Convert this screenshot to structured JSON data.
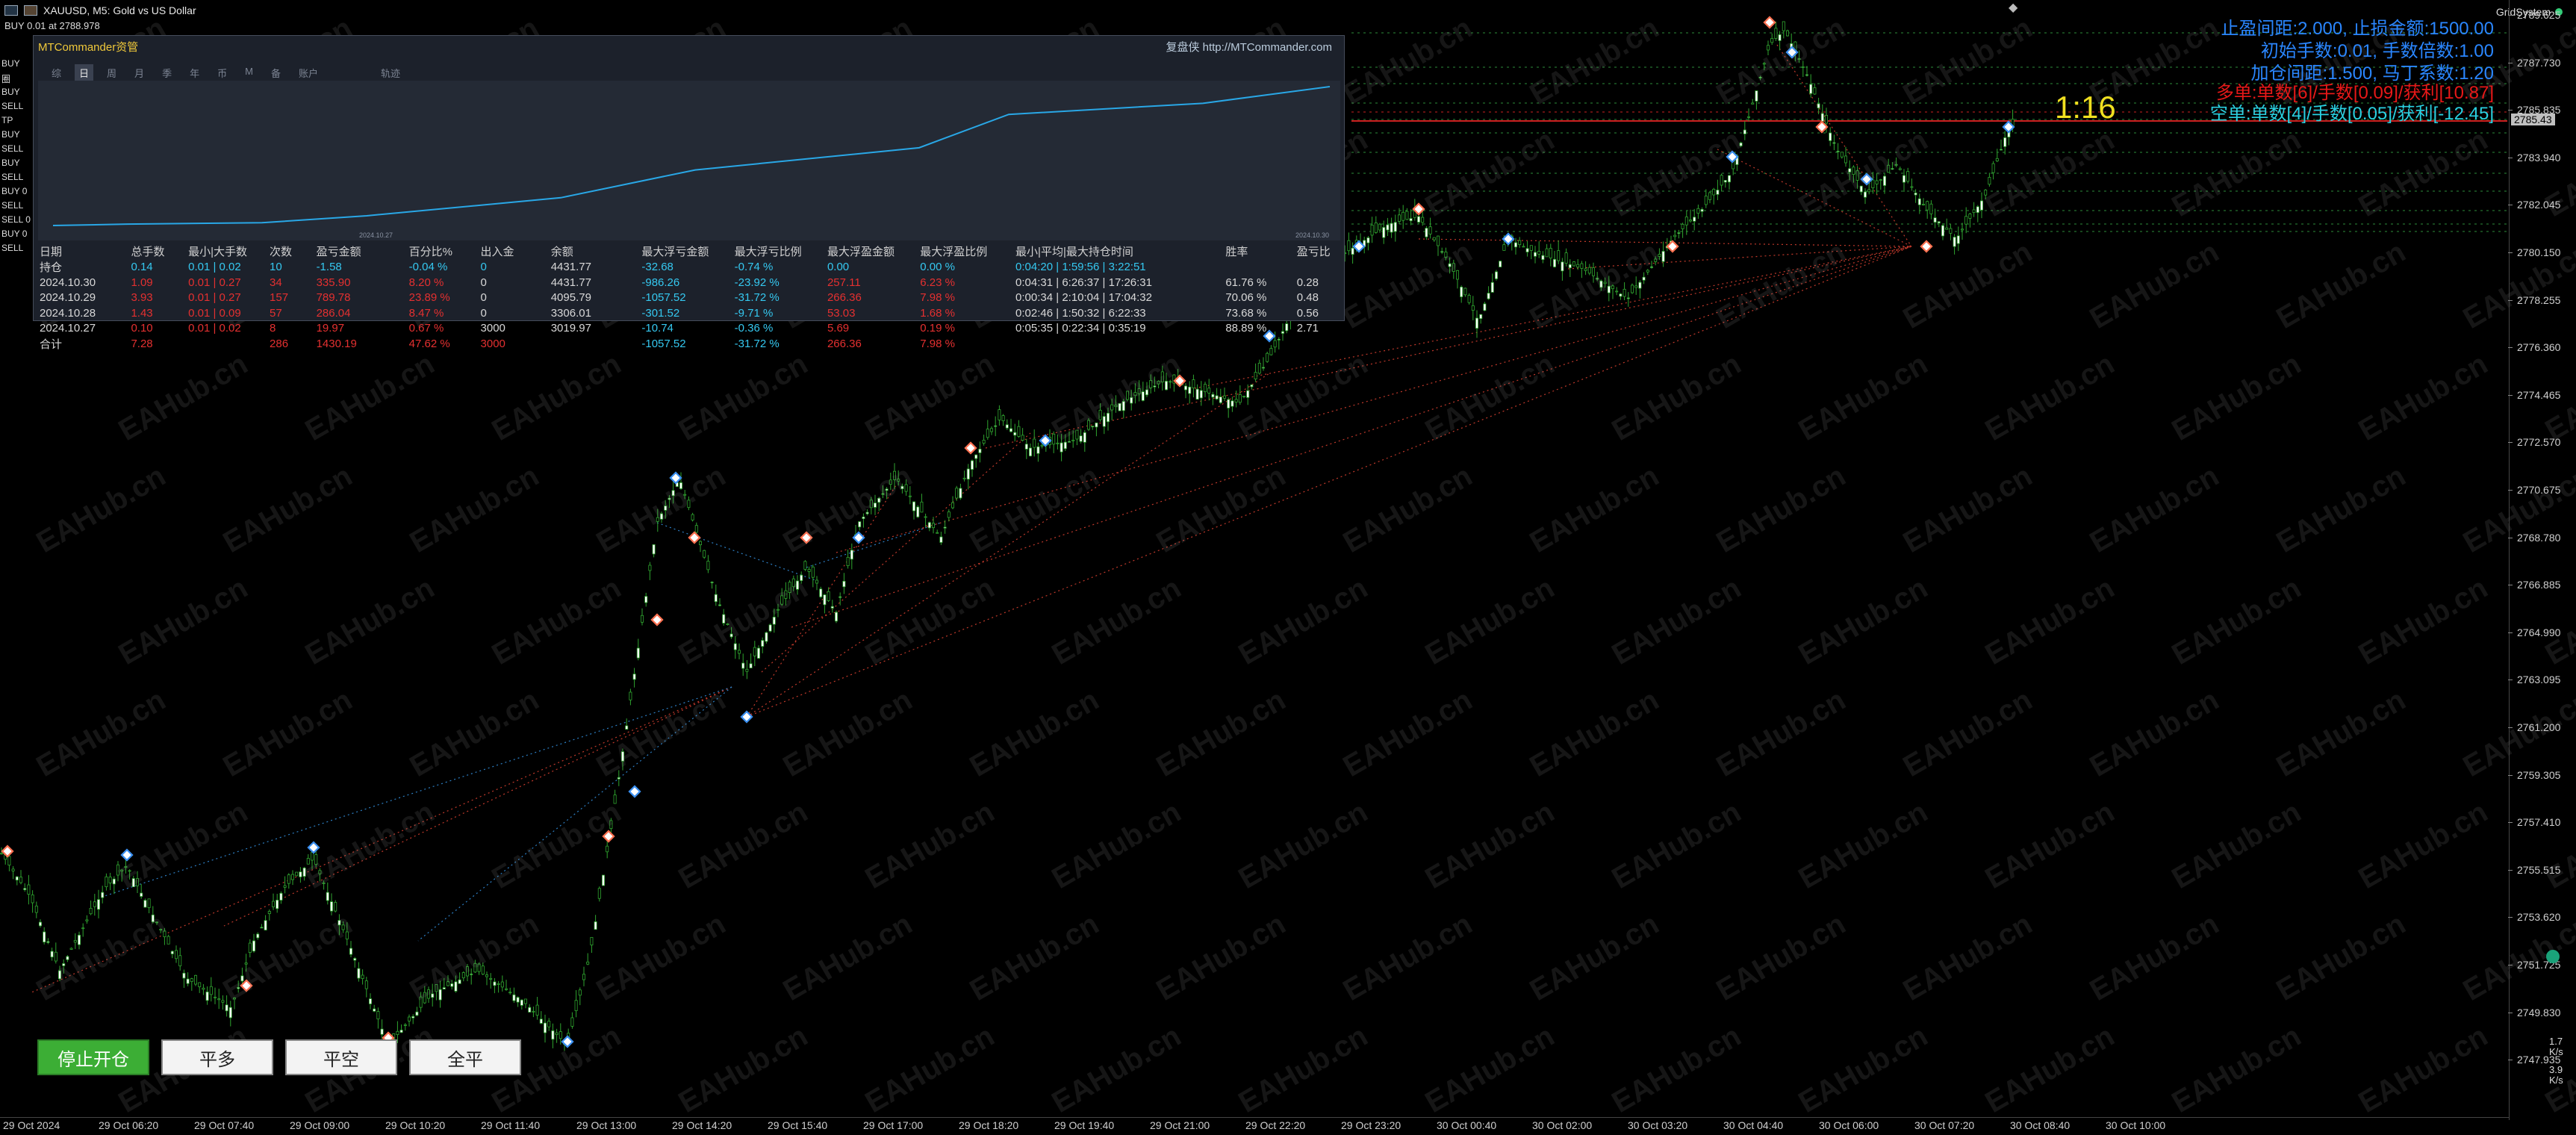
{
  "chart": {
    "symbol_title": "XAUUSD, M5:  Gold vs US Dollar",
    "order_line": "BUY 0.01 at 2788.978",
    "ea_name": "GridSystem",
    "watermark": "EAHub.cn",
    "side_labels": [
      "BUY",
      "圈",
      "BUY",
      "SELL",
      "TP",
      "BUY",
      "SELL",
      "BUY",
      "SELL",
      "BUY 0",
      "SELL",
      "SELL 0",
      "BUY 0",
      "SELL"
    ]
  },
  "panel": {
    "title": "MTCommander资管",
    "replay": "复盘侠 http://MTCommander.com",
    "tabs": [
      "综",
      "日",
      "周",
      "月",
      "季",
      "年",
      "币",
      "M",
      "备",
      "账户",
      "轨迹"
    ],
    "active_tab": "日",
    "curve_start_label": "2024.10.27",
    "curve_mid_label": "2024.10.27",
    "curve_end_label": "2024.10.30",
    "balance_curve": [
      0,
      1,
      2,
      7,
      20,
      40,
      56,
      80,
      88,
      100
    ],
    "headers": [
      "日期",
      "总手数",
      "最小|大手数",
      "次数",
      "盈亏金额",
      "百分比%",
      "出入金",
      "余额",
      "最大浮亏金额",
      "最大浮亏比例",
      "最大浮盈金额",
      "最大浮盈比例",
      "最小|平均|最大持仓时间",
      "胜率",
      "盈亏比"
    ],
    "rows": [
      {
        "cells": [
          "持仓",
          "0.14",
          "0.01 | 0.02",
          "10",
          "-1.58",
          "-0.04 %",
          "0",
          "4431.77",
          "-32.68",
          "-0.74 %",
          "0.00",
          "0.00 %",
          "0:04:20 | 1:59:56 | 3:22:51",
          "",
          ""
        ],
        "tone": "cyan"
      },
      {
        "cells": [
          "2024.10.30",
          "1.09",
          "0.01 | 0.27",
          "34",
          "335.90",
          "8.20 %",
          "0",
          "4431.77",
          "-986.26",
          "-23.92 %",
          "257.11",
          "6.23 %",
          "0:04:31 | 6:26:37 | 17:26:31",
          "61.76 %",
          "0.28"
        ],
        "tone": "red"
      },
      {
        "cells": [
          "2024.10.29",
          "3.93",
          "0.01 | 0.27",
          "157",
          "789.78",
          "23.89 %",
          "0",
          "4095.79",
          "-1057.52",
          "-31.72 %",
          "266.36",
          "7.98 %",
          "0:00:34 | 2:10:04 | 17:04:32",
          "70.06 %",
          "0.48"
        ],
        "tone": "red"
      },
      {
        "cells": [
          "2024.10.28",
          "1.43",
          "0.01 | 0.09",
          "57",
          "286.04",
          "8.47 %",
          "0",
          "3306.01",
          "-301.52",
          "-9.71 %",
          "53.03",
          "1.68 %",
          "0:02:46 | 1:50:32 | 6:22:33",
          "73.68 %",
          "0.56"
        ],
        "tone": "red"
      },
      {
        "cells": [
          "2024.10.27",
          "0.10",
          "0.01 | 0.02",
          "8",
          "19.97",
          "0.67 %",
          "3000",
          "3019.97",
          "-10.74",
          "-0.36 %",
          "5.69",
          "0.19 %",
          "0:05:35 | 0:22:34 | 0:35:19",
          "88.89 %",
          "2.71"
        ],
        "tone": "red"
      },
      {
        "cells": [
          "合计",
          "7.28",
          "",
          "286",
          "1430.19",
          "47.62 %",
          "3000",
          "",
          "-1057.52",
          "-31.72 %",
          "266.36",
          "7.98 %",
          "",
          "",
          ""
        ],
        "tone": "sum"
      }
    ]
  },
  "price_axis": {
    "ticks": [
      "2789.625",
      "2787.730",
      "2785.835",
      "2783.940",
      "2782.045",
      "2780.150",
      "2778.255",
      "2776.360",
      "2774.465",
      "2772.570",
      "2770.675",
      "2768.780",
      "2766.885",
      "2764.990",
      "2763.095",
      "2761.200",
      "2759.305",
      "2757.410",
      "2755.515",
      "2753.620",
      "2751.725",
      "2749.830",
      "2747.935"
    ],
    "current_price": "2785.43"
  },
  "time_axis": {
    "labels": [
      "29 Oct 2024",
      "29 Oct 06:20",
      "29 Oct 07:40",
      "29 Oct 09:00",
      "29 Oct 10:20",
      "29 Oct 11:40",
      "29 Oct 13:00",
      "29 Oct 14:20",
      "29 Oct 15:40",
      "29 Oct 17:00",
      "29 Oct 18:20",
      "29 Oct 19:40",
      "29 Oct 21:00",
      "29 Oct 22:20",
      "29 Oct 23:20",
      "30 Oct 00:40",
      "30 Oct 02:00",
      "30 Oct 03:20",
      "30 Oct 04:40",
      "30 Oct 06:00",
      "30 Oct 07:20",
      "30 Oct 08:40",
      "30 Oct 10:00"
    ]
  },
  "info": {
    "line1": "止盈间距:2.000, 止损金额:1500.00",
    "line2": "初始手数:0.01, 手数倍数:1.00",
    "line3": "加仓间距:1.500, 马丁系数:1.20",
    "line4": "多单:单数[6]/手数[0.09]/获利[10.87]",
    "line5": "空单:单数[4]/手数[0.05]/获利[-12.45]",
    "timer": "1:16",
    "colors": {
      "blue": "#2a86ff",
      "red": "#e81818",
      "cyan": "#2ad0e0",
      "yellow": "#f0e020"
    }
  },
  "buttons": {
    "stop": "停止开仓",
    "close_long": "平多",
    "close_short": "平空",
    "close_all": "全平"
  },
  "status": {
    "speed1": "1.7",
    "speed2": "3.9",
    "unit": "K/s"
  }
}
